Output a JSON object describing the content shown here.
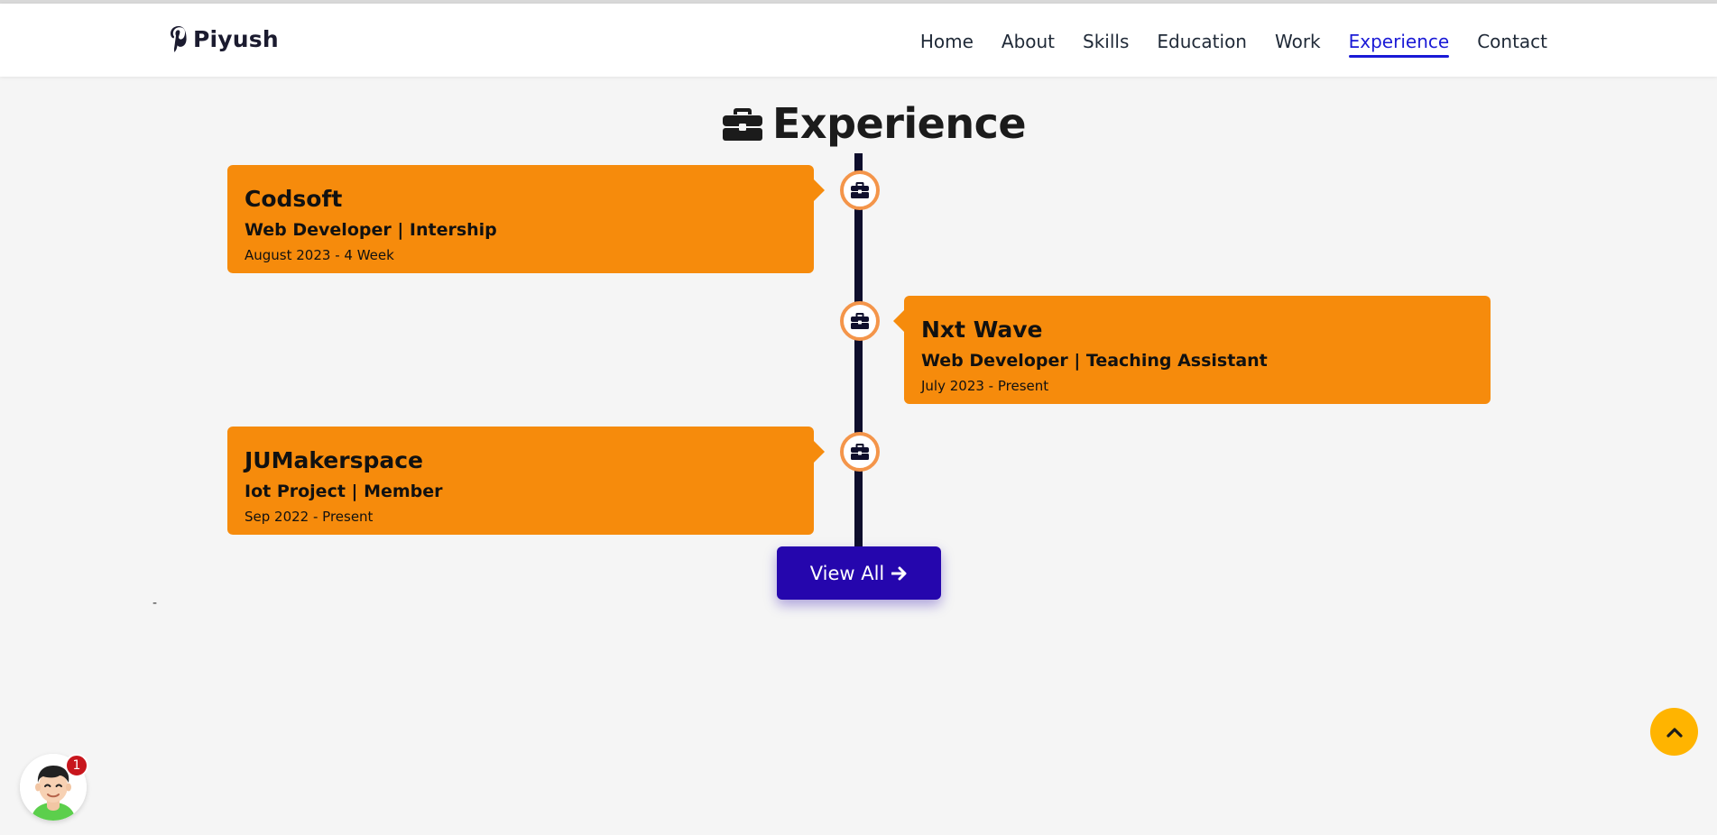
{
  "brand": {
    "name": "Piyush",
    "icon": "pinterest-icon"
  },
  "nav": {
    "items": [
      {
        "label": "Home"
      },
      {
        "label": "About"
      },
      {
        "label": "Skills"
      },
      {
        "label": "Education"
      },
      {
        "label": "Work"
      },
      {
        "label": "Experience",
        "active": true
      },
      {
        "label": "Contact"
      }
    ]
  },
  "section": {
    "title": "Experience",
    "icon": "briefcase-icon"
  },
  "experiences": [
    {
      "company": "Codsoft",
      "role": "Web Developer | Intership",
      "date": "August 2023 - 4 Week",
      "side": "left"
    },
    {
      "company": "Nxt Wave",
      "role": "Web Developer | Teaching Assistant",
      "date": "July 2023 - Present",
      "side": "right"
    },
    {
      "company": "JUMakerspace",
      "role": "Iot Project | Member",
      "date": "Sep 2022 - Present",
      "side": "left"
    }
  ],
  "view_all": {
    "label": "View All",
    "icon": "arrow-right-icon"
  },
  "misc": {
    "dash": "-"
  },
  "chat": {
    "badge_count": "1",
    "icon": "avatar-icon"
  },
  "scroll_top": {
    "icon": "chevron-up-icon"
  },
  "colors": {
    "accent": "#1a1ad6",
    "card": "#f68b0c",
    "timeline": "#0e0e2c",
    "marker_ring": "#f4954a",
    "button": "#2506ad",
    "scroll_top": "#ffb400",
    "badge": "#c8161d"
  }
}
